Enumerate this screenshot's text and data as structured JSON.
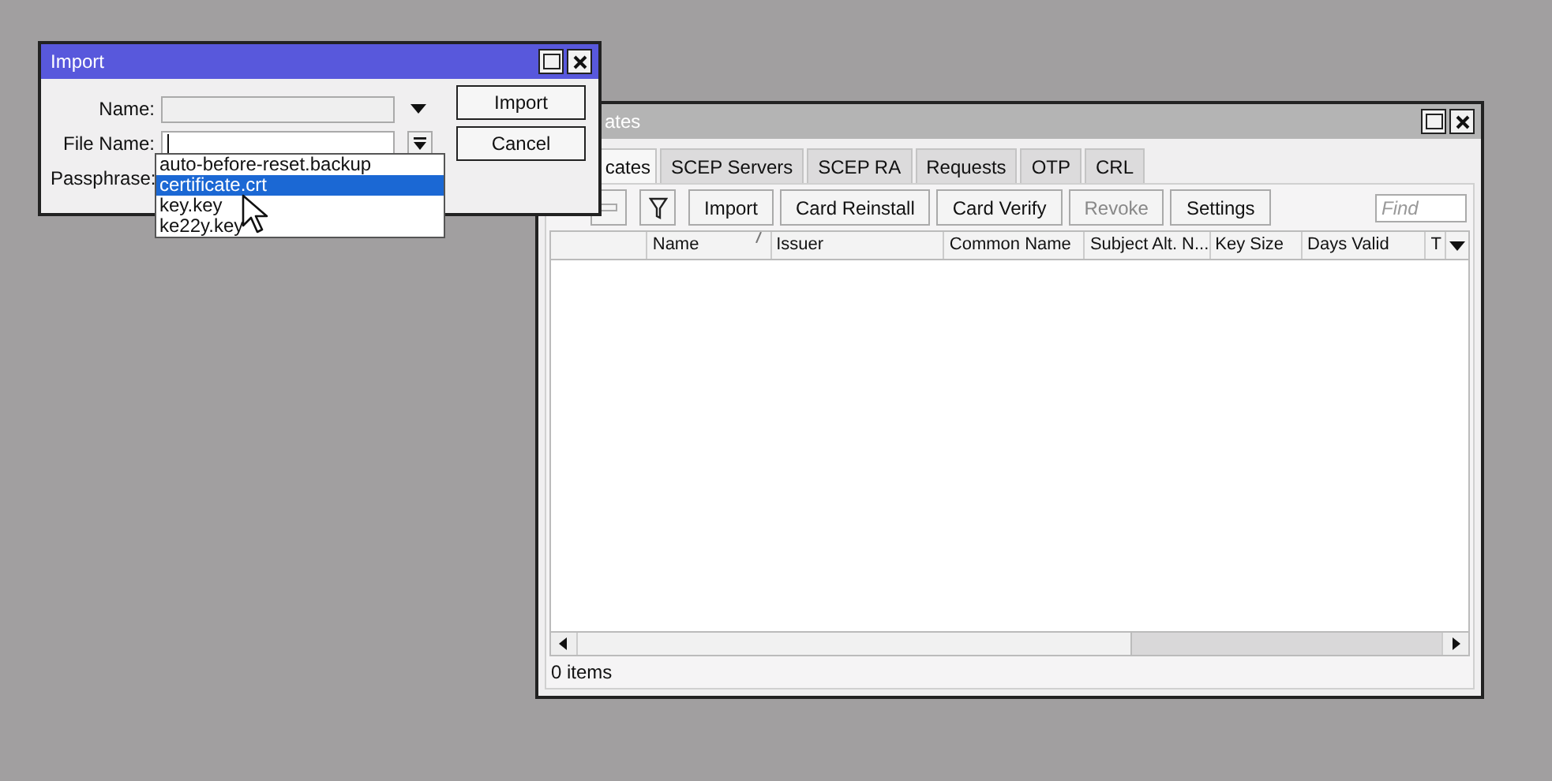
{
  "cert_window": {
    "title": "ates",
    "tabs": [
      {
        "label": "cates",
        "selected": true
      },
      {
        "label": "SCEP Servers",
        "selected": false
      },
      {
        "label": "SCEP RA",
        "selected": false
      },
      {
        "label": "Requests",
        "selected": false
      },
      {
        "label": "OTP",
        "selected": false
      },
      {
        "label": "CRL",
        "selected": false
      }
    ],
    "toolbar": [
      {
        "kind": "minus",
        "disabled": true
      },
      {
        "kind": "filter"
      },
      {
        "kind": "text",
        "label": "Import",
        "disabled": false
      },
      {
        "kind": "text",
        "label": "Card Reinstall",
        "disabled": false
      },
      {
        "kind": "text",
        "label": "Card Verify",
        "disabled": false
      },
      {
        "kind": "text",
        "label": "Revoke",
        "disabled": true
      },
      {
        "kind": "text",
        "label": "Settings",
        "disabled": false
      }
    ],
    "search": {
      "placeholder": "Find"
    },
    "columns": [
      {
        "sorted": false
      },
      {
        "label": "Name",
        "sorted": true
      },
      {
        "label": "Issuer",
        "sorted": false
      },
      {
        "label": "Common Name",
        "sorted": false
      },
      {
        "label": "Subject Alt. N...",
        "sorted": false
      },
      {
        "label": "Key Size",
        "sorted": false
      },
      {
        "label": "Days Valid",
        "sorted": false
      },
      {
        "label": "T",
        "sorted": false
      }
    ],
    "status_bar": "0 items"
  },
  "import_dialog": {
    "title": "Import",
    "fields": [
      {
        "label": "Name:",
        "kind": "combo"
      },
      {
        "label": "File Name:",
        "kind": "file"
      },
      {
        "label": "Passphrase:",
        "kind": "text"
      }
    ],
    "buttons": [
      "Import",
      "Cancel"
    ],
    "file_options": [
      {
        "label": "auto-before-reset.backup",
        "selected": false
      },
      {
        "label": "certificate.crt",
        "selected": true
      },
      {
        "label": "key.key",
        "selected": false
      },
      {
        "label": "ke22y.key",
        "selected": false
      }
    ]
  }
}
